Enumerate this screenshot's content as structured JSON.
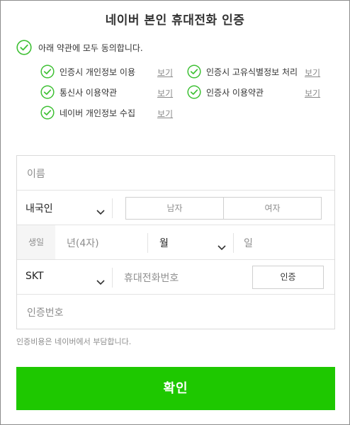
{
  "header": {
    "title": "네이버 본인 휴대전화 인증"
  },
  "agreement": {
    "all_label": "아래 약관에 모두 동의합니다.",
    "view_label": "보기",
    "terms": [
      {
        "label": "인증시 개인정보 이용"
      },
      {
        "label": "인증시 고유식별정보 처리"
      },
      {
        "label": "통신사 이용약관"
      },
      {
        "label": "인증사 이용약관"
      },
      {
        "label": "네이버 개인정보 수집"
      }
    ]
  },
  "form": {
    "name_placeholder": "이름",
    "nationality_value": "내국인",
    "gender_male": "남자",
    "gender_female": "여자",
    "birth_label": "생일",
    "year_placeholder": "년(4자)",
    "month_placeholder": "월",
    "day_placeholder": "일",
    "carrier_value": "SKT",
    "phone_placeholder": "휴대전화번호",
    "verify_button": "인증",
    "code_placeholder": "인증번호"
  },
  "notice": "인증비용은 네이버에서 부담합니다.",
  "confirm_button": "확인",
  "colors": {
    "accent": "#1ec800",
    "check": "#3ec034"
  }
}
